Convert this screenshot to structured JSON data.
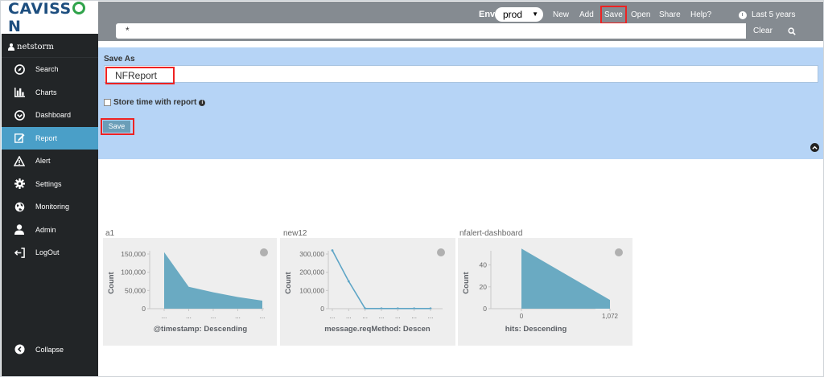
{
  "logo": {
    "before": "CAVISS",
    "after": "N"
  },
  "user": {
    "name": "netstorm"
  },
  "sidebar": {
    "items": [
      {
        "label": "Search",
        "icon": "compass-icon"
      },
      {
        "label": "Charts",
        "icon": "bar-chart-icon"
      },
      {
        "label": "Dashboard",
        "icon": "gauge-icon"
      },
      {
        "label": "Report",
        "icon": "edit-icon",
        "active": true
      },
      {
        "label": "Alert",
        "icon": "warning-icon"
      },
      {
        "label": "Settings",
        "icon": "gear-icon"
      },
      {
        "label": "Monitoring",
        "icon": "globe-icon"
      },
      {
        "label": "Admin",
        "icon": "user-icon"
      },
      {
        "label": "LogOut",
        "icon": "logout-icon"
      }
    ],
    "collapse_label": "Collapse"
  },
  "topbar": {
    "env_label": "Env",
    "env_value": "prod",
    "menu": {
      "new": "New",
      "add": "Add",
      "save": "Save",
      "open": "Open",
      "share": "Share",
      "help": "Help?"
    },
    "time_range": "Last 5 years",
    "query": "*",
    "clear_label": "Clear"
  },
  "save_panel": {
    "title": "Save As",
    "name_value": "NFReport",
    "store_time_label": "Store time with report",
    "save_button": "Save"
  },
  "panels": [
    {
      "title": "a1",
      "y_label": "Count",
      "x_label": "@timestamp: Descending"
    },
    {
      "title": "new12",
      "y_label": "Count",
      "x_label": "message.reqMethod: Descen"
    },
    {
      "title": "nfalert-dashboard",
      "y_label": "Count",
      "x_label": "hits: Descending"
    }
  ],
  "chart_data": [
    {
      "type": "area",
      "ylabel": "Count",
      "xlabel": "@timestamp: Descending",
      "y_ticks": [
        "150,000",
        "100,000",
        "50,000",
        "0"
      ],
      "ylim": [
        0,
        150000
      ],
      "x_ticks": [
        "...",
        "...",
        "...",
        "...",
        "..."
      ],
      "x": [
        0,
        1,
        2,
        3,
        4
      ],
      "values": [
        155000,
        60000,
        45000,
        32000,
        22000
      ],
      "color": "#6aaac2"
    },
    {
      "type": "line",
      "ylabel": "Count",
      "xlabel": "message.reqMethod: Descen",
      "y_ticks": [
        "300,000",
        "200,000",
        "100,000",
        "0"
      ],
      "ylim": [
        0,
        300000
      ],
      "x_ticks": [
        "...",
        "...",
        "...",
        "...",
        "...",
        "...",
        "..."
      ],
      "x": [
        0,
        1,
        2,
        3,
        4,
        5,
        6
      ],
      "values": [
        320000,
        150000,
        1000,
        1000,
        1000,
        1000,
        1000
      ],
      "color": "#5ea5c6"
    },
    {
      "type": "area",
      "ylabel": "Count",
      "xlabel": "hits: Descending",
      "y_ticks": [
        "40",
        "20",
        "0"
      ],
      "ylim": [
        0,
        50
      ],
      "x_ticks": [
        "0",
        "1,072"
      ],
      "x": [
        0,
        1072
      ],
      "values": [
        55,
        8
      ],
      "color": "#6aaac2"
    }
  ]
}
